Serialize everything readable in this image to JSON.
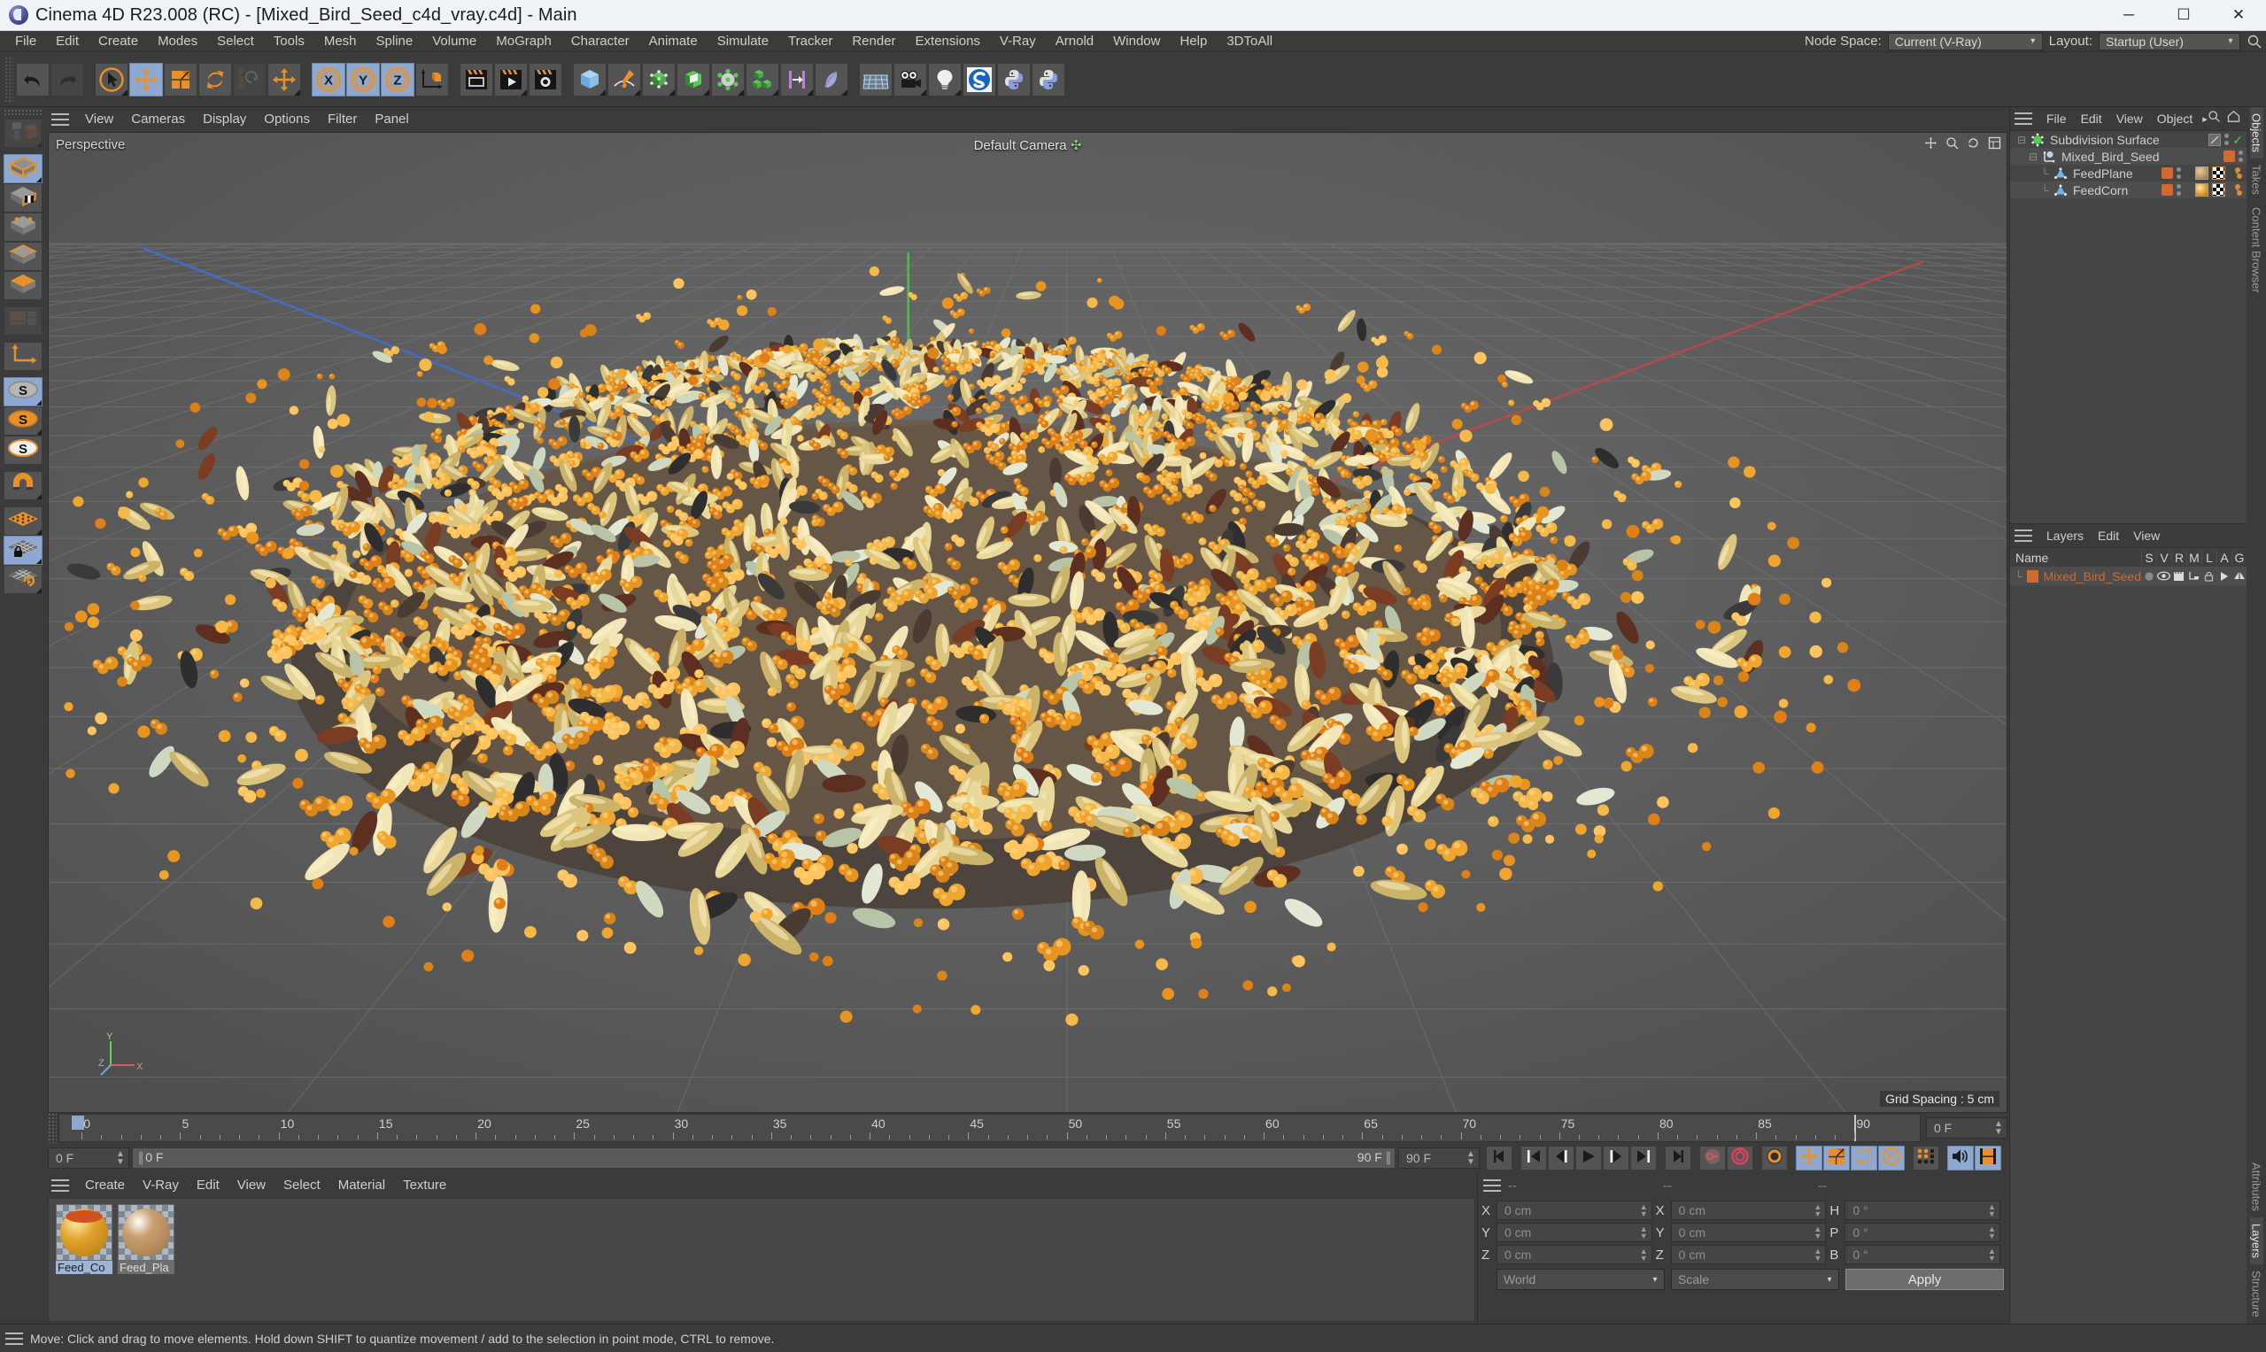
{
  "window": {
    "title": "Cinema 4D R23.008 (RC) - [Mixed_Bird_Seed_c4d_vray.c4d] - Main",
    "minimize": "─",
    "maximize": "☐",
    "close": "✕"
  },
  "menubar": {
    "items": [
      "File",
      "Edit",
      "Create",
      "Modes",
      "Select",
      "Tools",
      "Mesh",
      "Spline",
      "Volume",
      "MoGraph",
      "Character",
      "Animate",
      "Simulate",
      "Tracker",
      "Render",
      "Extensions",
      "V-Ray",
      "Arnold",
      "Window",
      "Help",
      "3DToAll"
    ],
    "node_space_label": "Node Space:",
    "node_space_value": "Current (V-Ray)",
    "layout_label": "Layout:",
    "layout_value": "Startup (User)",
    "search_icon": "search-icon"
  },
  "toolbar": {
    "groups": [
      {
        "buttons": [
          {
            "name": "undo-button",
            "icon": "undo-icon",
            "state": "normal"
          },
          {
            "name": "redo-button",
            "icon": "redo-icon",
            "state": "disabled"
          }
        ]
      },
      {
        "buttons": [
          {
            "name": "live-selection-tool",
            "icon": "cursor-circle-icon",
            "state": "normal",
            "corner": true
          },
          {
            "name": "move-tool",
            "icon": "move-arrows-icon",
            "state": "selected"
          },
          {
            "name": "scale-tool",
            "icon": "scale-box-icon",
            "state": "normal"
          },
          {
            "name": "rotate-tool",
            "icon": "rotate-icon",
            "state": "normal"
          },
          {
            "name": "psr-lock-tool",
            "icon": "psr-icon",
            "state": "disabled"
          },
          {
            "name": "world-object-axis-tool",
            "icon": "move-arrows-icon",
            "state": "normal",
            "corner": true
          }
        ]
      },
      {
        "buttons": [
          {
            "name": "lock-x-axis-button",
            "icon": "x-axis-icon",
            "state": "selected"
          },
          {
            "name": "lock-y-axis-button",
            "icon": "y-axis-icon",
            "state": "selected"
          },
          {
            "name": "lock-z-axis-button",
            "icon": "z-axis-icon",
            "state": "selected"
          },
          {
            "name": "world-coordinate-system-button",
            "icon": "axis-cube-icon",
            "state": "normal"
          }
        ]
      },
      {
        "buttons": [
          {
            "name": "render-view-button",
            "icon": "clapper-frame-icon",
            "state": "normal"
          },
          {
            "name": "render-to-picture-viewer-button",
            "icon": "clapper-play-icon",
            "state": "normal",
            "corner": true
          },
          {
            "name": "render-settings-button",
            "icon": "clapper-gear-icon",
            "state": "normal"
          }
        ]
      },
      {
        "buttons": [
          {
            "name": "add-cube-button",
            "icon": "cube-blue-icon",
            "state": "normal",
            "corner": true
          },
          {
            "name": "add-spline-button",
            "icon": "pen-spline-icon",
            "state": "normal",
            "corner": true
          },
          {
            "name": "add-null-generator-button",
            "icon": "generator-green-icon",
            "state": "normal",
            "corner": true
          },
          {
            "name": "add-bend-deformer-button",
            "icon": "deformer-green-icon",
            "state": "normal",
            "corner": true
          },
          {
            "name": "add-subdivision-button",
            "icon": "subdiv-green-icon",
            "state": "normal",
            "corner": true
          },
          {
            "name": "add-array-button",
            "icon": "array-green-icon",
            "state": "normal",
            "corner": true
          },
          {
            "name": "add-mograph-button",
            "icon": "mograph-icon",
            "state": "normal",
            "corner": true
          },
          {
            "name": "add-field-button",
            "icon": "field-blue-icon",
            "state": "normal",
            "corner": true
          }
        ]
      },
      {
        "buttons": [
          {
            "name": "add-floor-button",
            "icon": "floor-grid-icon",
            "state": "normal"
          },
          {
            "name": "add-camera-button",
            "icon": "camera-icon",
            "state": "normal",
            "corner": true
          },
          {
            "name": "add-light-button",
            "icon": "light-bulb-icon",
            "state": "normal",
            "corner": true
          },
          {
            "name": "substance-button",
            "icon": "substance-s-icon",
            "state": "normal"
          },
          {
            "name": "python-script-button",
            "icon": "python-icon",
            "state": "normal"
          },
          {
            "name": "python-generator-button",
            "icon": "python-icon",
            "state": "normal"
          }
        ]
      }
    ]
  },
  "lefttools": {
    "buttons": [
      {
        "name": "make-editable-button",
        "icon": "make-editable-icon",
        "state": "disabled",
        "corner": true
      },
      {
        "name": "model-mode-button",
        "icon": "model-cube-icon",
        "state": "selected",
        "corner": true
      },
      {
        "name": "texture-mode-button",
        "icon": "texture-cube-icon",
        "state": "normal"
      },
      {
        "name": "points-mode-button",
        "icon": "points-cube-icon",
        "state": "normal"
      },
      {
        "name": "edges-mode-button",
        "icon": "edges-cube-icon",
        "state": "normal"
      },
      {
        "name": "polygons-mode-button",
        "icon": "polygons-cube-icon",
        "state": "normal"
      },
      {
        "name": "uv-mode-button",
        "icon": "uv-icon",
        "state": "disabled"
      },
      {
        "name": "object-axis-mode-button",
        "icon": "axis-icon",
        "state": "normal"
      },
      {
        "name": "enable-snapping-button",
        "icon": "snap-s-grey-icon",
        "state": "selected",
        "corner": true
      },
      {
        "name": "snap-settings-button",
        "icon": "snap-s-orange-icon",
        "state": "normal",
        "corner": true
      },
      {
        "name": "quantize-button",
        "icon": "snap-s-white-icon",
        "state": "normal"
      },
      {
        "name": "magnet-tool-button",
        "icon": "magnet-icon",
        "state": "normal",
        "corner": true
      },
      {
        "name": "workplane-button",
        "icon": "workplane-icon",
        "state": "normal",
        "corner": true
      },
      {
        "name": "lock-workplane-button",
        "icon": "lock-workplane-icon",
        "state": "selected",
        "corner": true
      },
      {
        "name": "planar-workplane-button",
        "icon": "planar-workplane-icon",
        "state": "normal",
        "corner": true
      }
    ]
  },
  "viewport": {
    "menu": [
      "View",
      "Cameras",
      "Display",
      "Options",
      "Filter",
      "Panel"
    ],
    "label": "Perspective",
    "camera": "Default Camera",
    "grid_spacing": "Grid Spacing : 5 cm",
    "icons": [
      "pan-icon",
      "zoom-icon",
      "rotate-view-icon",
      "maximize-view-icon"
    ],
    "axis_gizmo": {
      "y": "Y",
      "x": "X",
      "z": "Z"
    }
  },
  "timeline": {
    "ticks": [
      0,
      5,
      10,
      15,
      20,
      25,
      30,
      35,
      40,
      45,
      50,
      55,
      60,
      65,
      70,
      75,
      80,
      85,
      90
    ],
    "current_frame_field": "0 F",
    "playhead_frame": 90
  },
  "powerslider": {
    "left_field": "0 F",
    "track_left": "0 F",
    "track_right": "90 F",
    "end_field": "90 F",
    "buttons": [
      {
        "name": "go-to-start-button",
        "icon": "skip-start-icon",
        "state": "normal"
      },
      {
        "name": "go-to-first-frame-button",
        "icon": "first-frame-icon",
        "state": "normal"
      },
      {
        "name": "step-back-button",
        "icon": "step-back-icon",
        "state": "normal"
      },
      {
        "name": "play-button",
        "icon": "play-icon",
        "state": "normal"
      },
      {
        "name": "step-forward-button",
        "icon": "step-forward-icon",
        "state": "normal"
      },
      {
        "name": "go-to-last-frame-button",
        "icon": "last-frame-icon",
        "state": "normal"
      },
      {
        "name": "go-to-end-button",
        "icon": "skip-end-icon",
        "state": "normal"
      },
      {
        "name": "record-key-button",
        "icon": "key-record-icon",
        "state": "normal"
      },
      {
        "name": "autokey-button",
        "icon": "autokey-icon",
        "state": "normal"
      },
      {
        "name": "keyframe-settings-button",
        "icon": "gear-key-icon",
        "state": "normal"
      },
      {
        "name": "position-key-button",
        "icon": "position-key-icon",
        "state": "selected"
      },
      {
        "name": "scale-key-button",
        "icon": "scale-key-icon",
        "state": "selected"
      },
      {
        "name": "rotation-key-button",
        "icon": "rotation-key-icon",
        "state": "selected"
      },
      {
        "name": "parameter-key-button",
        "icon": "param-key-icon",
        "state": "selected"
      },
      {
        "name": "point-level-anim-button",
        "icon": "pla-dots-icon",
        "state": "normal"
      },
      {
        "name": "sound-button",
        "icon": "sound-icon",
        "state": "selected"
      },
      {
        "name": "timeline-button",
        "icon": "filmstrip-icon",
        "state": "selected"
      }
    ]
  },
  "material_manager": {
    "menu": [
      "Create",
      "V-Ray",
      "Edit",
      "View",
      "Select",
      "Material",
      "Texture"
    ],
    "materials": [
      {
        "name": "Feed_Co",
        "full": "Feed_Corn",
        "selected": true,
        "color": "#e0a22a",
        "accent": "#d2521e"
      },
      {
        "name": "Feed_Pla",
        "full": "Feed_Plane",
        "selected": false,
        "color": "#c9a071",
        "accent": "#a07845"
      }
    ]
  },
  "coordinates": {
    "header": [
      "--",
      "--",
      "--"
    ],
    "rows": [
      {
        "labels": [
          "X",
          "X",
          "H"
        ],
        "values": [
          "0 cm",
          "0 cm",
          "0 °"
        ]
      },
      {
        "labels": [
          "Y",
          "Y",
          "P"
        ],
        "values": [
          "0 cm",
          "0 cm",
          "0 °"
        ]
      },
      {
        "labels": [
          "Z",
          "Z",
          "B"
        ],
        "values": [
          "0 cm",
          "0 cm",
          "0 °"
        ]
      }
    ],
    "system": "World",
    "mode": "Scale",
    "apply": "Apply"
  },
  "object_manager": {
    "menu": [
      "File",
      "Edit",
      "View",
      "Object"
    ],
    "more": "▸",
    "icons": [
      "search-icon",
      "home-icon",
      "filter-icon",
      "add-layer-icon"
    ],
    "objects": [
      {
        "name": "Subdivision Surface",
        "icon": "subdivision-surface-icon",
        "depth": 0,
        "has_swatch": false,
        "has_check": true,
        "tags": []
      },
      {
        "name": "Mixed_Bird_Seed",
        "icon": "cloner-icon",
        "depth": 1,
        "has_swatch": true,
        "has_check": false,
        "tags": []
      },
      {
        "name": "FeedPlane",
        "icon": "polygon-object-icon",
        "depth": 2,
        "has_swatch": true,
        "has_check": false,
        "tags": [
          "material-tag",
          "uv-tag",
          "clone-tag"
        ]
      },
      {
        "name": "FeedCorn",
        "icon": "polygon-object-icon",
        "depth": 2,
        "has_swatch": true,
        "has_check": false,
        "tags": [
          "material-tag",
          "uv-tag",
          "clone-tag"
        ]
      }
    ]
  },
  "layer_manager": {
    "menu": [
      "Layers",
      "Edit",
      "View"
    ],
    "columns": [
      "Name",
      "S",
      "V",
      "R",
      "M",
      "L",
      "A",
      "G"
    ],
    "rows": [
      {
        "name": "Mixed_Bird_Seed",
        "color": "#d2692e"
      }
    ]
  },
  "vtabs": {
    "top": [
      "Objects",
      "Takes",
      "Content Browser"
    ],
    "bottom": [
      "Attributes",
      "Layers",
      "Structure"
    ]
  },
  "statusbar": {
    "text": "Move: Click and drag to move elements. Hold down SHIFT to quantize movement / add to the selection in point mode, CTRL to remove."
  },
  "colors": {
    "accent_orange": "#d2692e",
    "selected_blue": "#8fa8cf",
    "panel_bg": "#3b3b3b",
    "field_bg": "#454545",
    "viewport_bg": "#5b5b5b"
  }
}
